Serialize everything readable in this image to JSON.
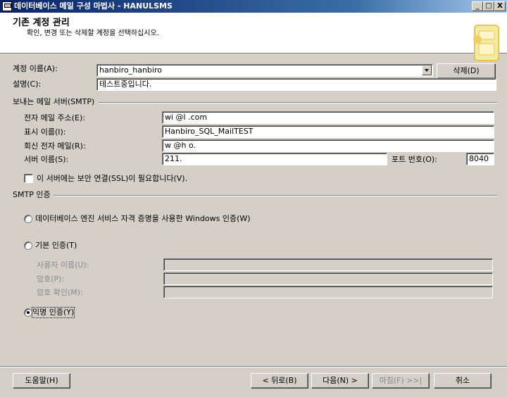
{
  "window": {
    "title": "데이터베이스 메일 구성 마법사 - HANULSMS",
    "buttons": [
      "_",
      "□",
      "X"
    ]
  },
  "header": {
    "title": "기존 계정 관리",
    "subtitle": "확인, 변경 또는 삭제할 계정을 선택하십시오."
  },
  "account": {
    "name_label": "계정 이름(A):",
    "name_value": "hanbiro_hanbiro",
    "delete_button": "삭제(D)",
    "desc_label": "설명(C):",
    "desc_value": "테스트중입니다."
  },
  "smtp": {
    "group_label": "보내는 메일 서버(SMTP)",
    "email_label": "전자 메일 주소(E):",
    "email_value": "wi      @l      .com",
    "display_label": "표시 이름(I):",
    "display_value": "Hanbiro_SQL_MailTEST",
    "reply_label": "회신 전자 메일(R):",
    "reply_value": "w       @h      o.",
    "server_label": "서버 이름(S):",
    "server_value": "211.",
    "port_label": "포트 번호(O):",
    "port_value": "8040",
    "ssl_label": "이 서버에는 보안 연결(SSL)이 필요합니다(V)."
  },
  "auth": {
    "group_label": "SMTP 인증",
    "windows_auth": "데이터베이스 엔진 서비스 자격 증명을 사용한 Windows 인증(W)",
    "basic_auth": "기본 인증(T)",
    "username_label": "사용자 이름(U):",
    "password_label": "암호(P):",
    "confirm_label": "암호 확인(M):",
    "anonymous_auth": "익명 인증(Y)",
    "selected": "anonymous"
  },
  "footer": {
    "help": "도움말(H)",
    "back": "< 뒤로(B)",
    "next": "다음(N) >",
    "finish": "마침(F) >>|",
    "cancel": "취소"
  }
}
